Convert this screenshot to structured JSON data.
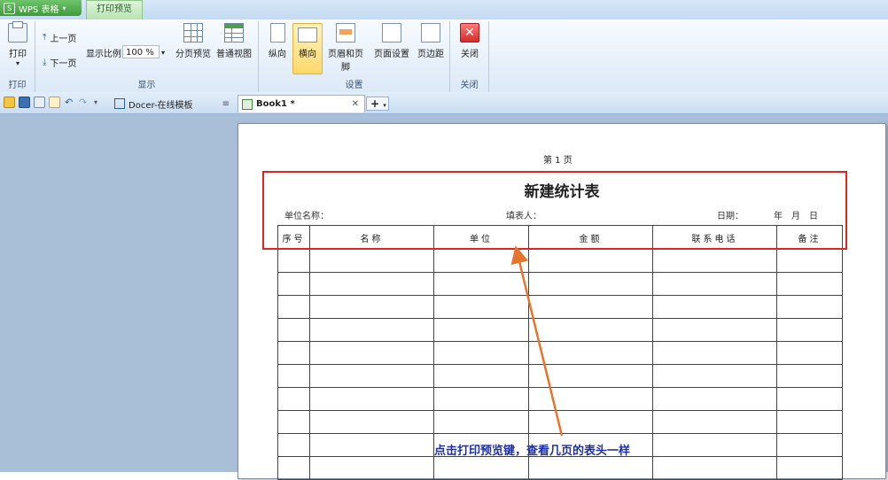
{
  "app": {
    "menu_button": "WPS 表格",
    "context_tab": "打印预览"
  },
  "ribbon": {
    "print_group": {
      "label": "打印",
      "print_button": "打印"
    },
    "page_group": {
      "label": "显示",
      "prev_page": "上一页",
      "next_page": "下一页",
      "zoom_label": "显示比例:",
      "zoom_value": "100 %",
      "page_break_preview": "分页预览",
      "normal_view": "普通视图"
    },
    "settings_group": {
      "label": "设置",
      "portrait": "纵向",
      "landscape": "横向",
      "margins": "页眉和页脚",
      "page_setup": "页面设置",
      "show_margins": "页边距"
    },
    "close_group": {
      "label": "关闭",
      "close_button": "关闭"
    }
  },
  "doc_tabs": {
    "tab1": "Docer-在线模板",
    "tab2": "Book1 *",
    "add_tab": "+"
  },
  "sheet": {
    "page_number": "第 1 页",
    "title": "新建统计表",
    "unit_label": "单位名称：",
    "filler_label": "填表人：",
    "date_label": "日期：",
    "date_parts": "年　月　日",
    "columns": [
      "序号",
      "名称",
      "单位",
      "金额",
      "联系电话",
      "备注"
    ],
    "row_count": 10
  },
  "annotation": {
    "text": "点击打印预览键，查看几页的表头一样",
    "highlight_color": "#e0241f",
    "arrow_color": "#e8742c",
    "text_color": "#1b2fa8"
  }
}
